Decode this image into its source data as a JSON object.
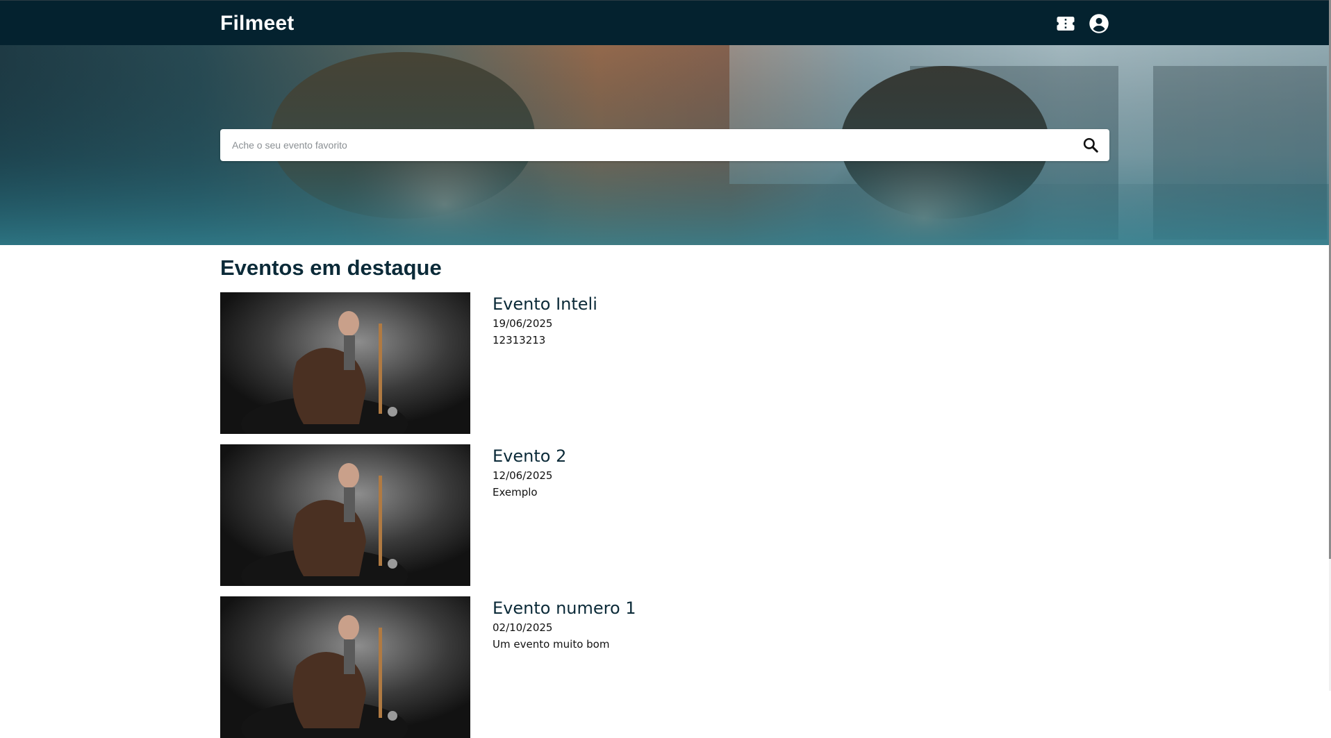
{
  "app": {
    "brand": "Filmeet"
  },
  "header": {
    "icons": [
      "ticket-icon",
      "account-circle-icon"
    ],
    "background": "#04222f"
  },
  "search": {
    "placeholder": "Ache o seu evento favorito",
    "value": ""
  },
  "featured": {
    "title": "Eventos em destaque",
    "events": [
      {
        "name": "Evento Inteli",
        "date": "19/06/2025",
        "description": "12313213"
      },
      {
        "name": "Evento 2",
        "date": "12/06/2025",
        "description": "Exemplo"
      },
      {
        "name": "Evento numero 1",
        "date": "02/10/2025",
        "description": "Um evento muito bom"
      }
    ]
  },
  "colors": {
    "primary": "#04222f",
    "heading": "#0b2a38",
    "hero_tint": "#2f6f7a"
  }
}
